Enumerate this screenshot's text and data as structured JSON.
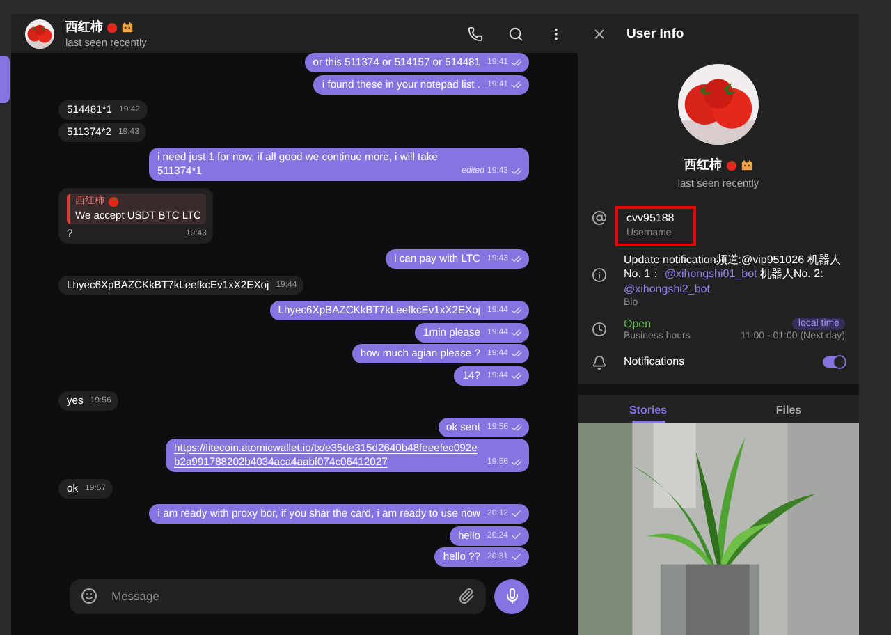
{
  "chat": {
    "title": "西红柿",
    "status": "last seen recently",
    "messages": [
      {
        "outgoing": true,
        "text": "or this 511374 or 514157 or  514481",
        "time": "19:41",
        "read": true
      },
      {
        "outgoing": true,
        "text": "i found these in your notepad list .",
        "time": "19:41",
        "read": true
      },
      {
        "outgoing": false,
        "text": "514481*1",
        "time": "19:42"
      },
      {
        "outgoing": false,
        "text": "511374*2",
        "time": "19:43"
      },
      {
        "outgoing": true,
        "text": "i need just 1 for now, if all good we continue more, i will take 511374*1",
        "time": "19:43",
        "read": true,
        "edit_mark": "edited"
      },
      {
        "outgoing": false,
        "text": "?",
        "time": "19:43",
        "quote": {
          "author": "西红柿",
          "text": "We accept USDT BTC LTC"
        }
      },
      {
        "outgoing": true,
        "text": "i can pay with LTC",
        "time": "19:43",
        "read": true
      },
      {
        "outgoing": false,
        "text": "Lhyec6XpBAZCKkBT7kLeefkcEv1xX2EXoj",
        "time": "19:44"
      },
      {
        "outgoing": true,
        "text": "Lhyec6XpBAZCKkBT7kLeefkcEv1xX2EXoj",
        "time": "19:44",
        "read": true
      },
      {
        "outgoing": true,
        "text": "1min please",
        "time": "19:44",
        "read": true
      },
      {
        "outgoing": true,
        "text": "how much agian please ?",
        "time": "19:44",
        "read": true
      },
      {
        "outgoing": true,
        "text": "14?",
        "time": "19:44",
        "read": true
      },
      {
        "outgoing": false,
        "text": "yes",
        "time": "19:56"
      },
      {
        "outgoing": true,
        "text": "ok sent",
        "time": "19:56",
        "read": true
      },
      {
        "outgoing": true,
        "kind": "link",
        "text": "https://litecoin.atomicwallet.io/tx/e35de315d2640b48feeefec092eb2a991788202b4034aca4aabf074c06412027",
        "time": "19:56",
        "read": true
      },
      {
        "outgoing": false,
        "text": "ok",
        "time": "19:57"
      },
      {
        "outgoing": true,
        "text": "i am ready with proxy bor, if you shar the card, i am ready to use now",
        "time": "20:12",
        "read": false
      },
      {
        "outgoing": true,
        "text": "hello",
        "time": "20:24",
        "read": false
      },
      {
        "outgoing": true,
        "text": "hello ??",
        "time": "20:31",
        "read": false
      }
    ],
    "composer": {
      "placeholder": "Message"
    }
  },
  "user_info": {
    "title": "User Info",
    "name": "西红柿",
    "status": "last seen recently",
    "username": {
      "value": "cvv95188",
      "label": "Username",
      "highlighted": true
    },
    "bio": {
      "parts": [
        {
          "text": "Update notification频道:@vip951026 机器人No. 1： ",
          "link": false
        },
        {
          "text": "@xihongshi01_bot",
          "link": true
        },
        {
          "text": " 机器人No. 2: ",
          "link": false
        },
        {
          "text": "@xihongshi2_bot",
          "link": true
        }
      ],
      "label": "Bio"
    },
    "business": {
      "status": "Open",
      "label": "Business hours",
      "badge": "local time",
      "hours": "11:00 - 01:00 (Next day)"
    },
    "notifications": {
      "label": "Notifications",
      "on": true
    },
    "tabs": [
      {
        "label": "Stories",
        "selected": true
      },
      {
        "label": "Files",
        "selected": false
      }
    ]
  }
}
